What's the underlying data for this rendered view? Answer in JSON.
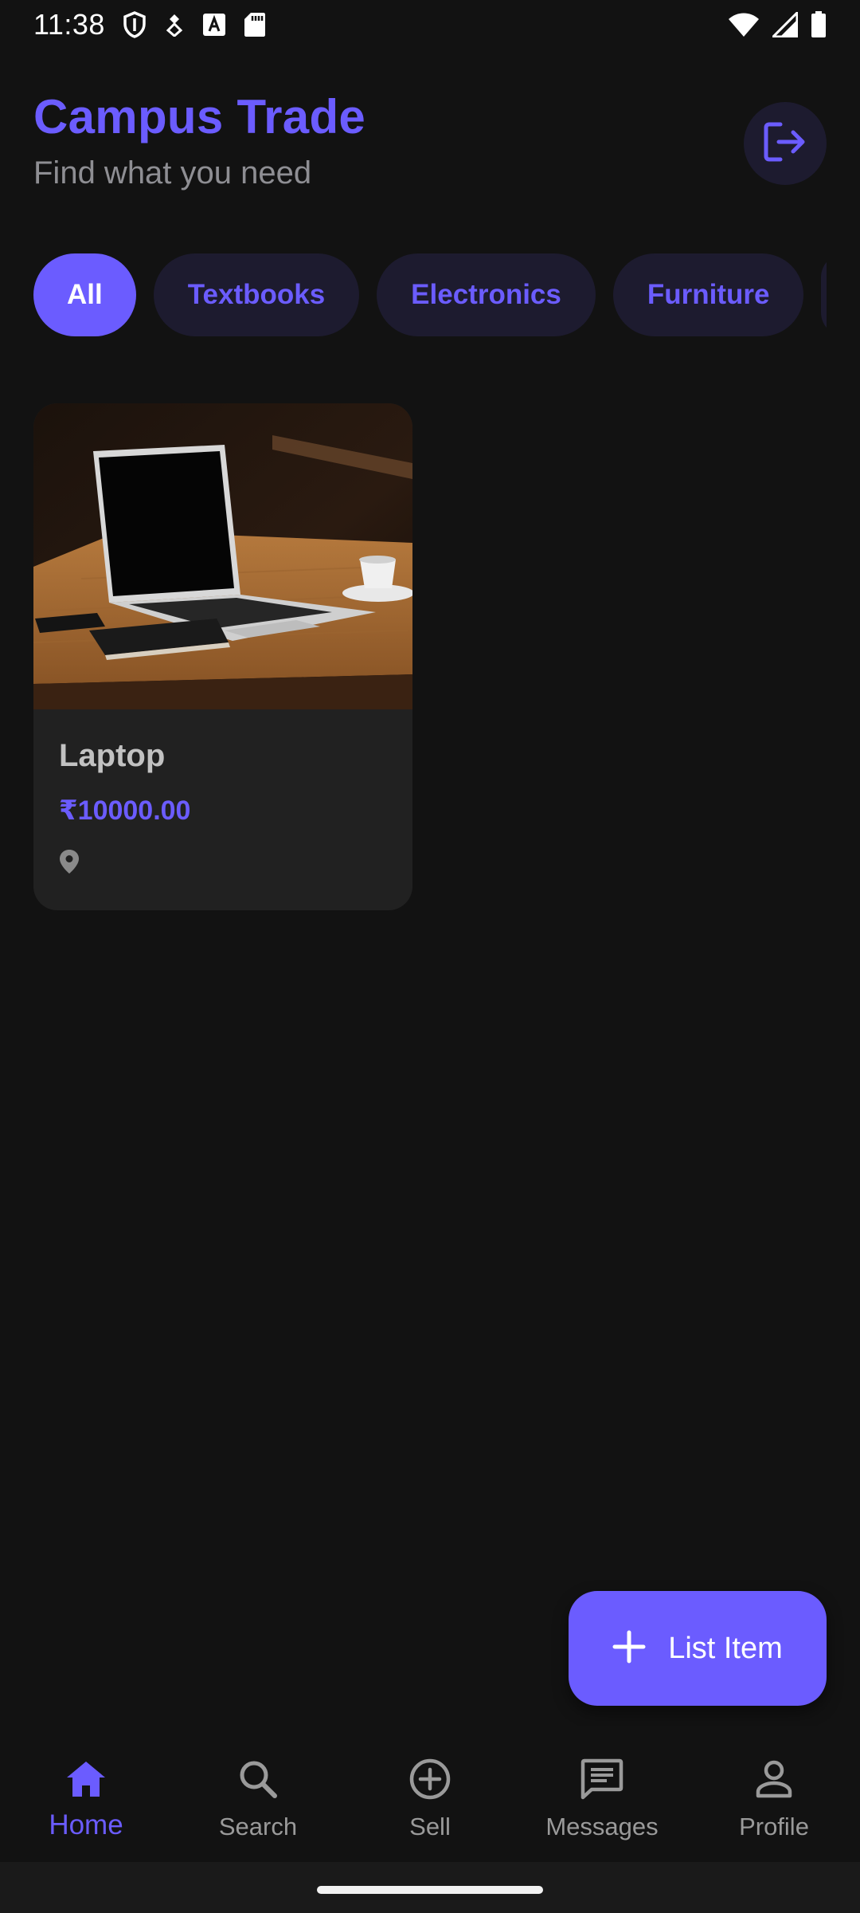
{
  "status_bar": {
    "time": "11:38",
    "left_icons": [
      "shield-icon",
      "diamond-icon",
      "font-a-icon",
      "sd-card-icon"
    ],
    "right_icons": [
      "wifi-icon",
      "signal-icon",
      "battery-icon"
    ]
  },
  "header": {
    "title": "Campus Trade",
    "subtitle": "Find what you need",
    "logout_icon": "logout-icon"
  },
  "categories": {
    "selected": "All",
    "items": [
      "All",
      "Textbooks",
      "Electronics",
      "Furniture"
    ]
  },
  "listings": [
    {
      "title": "Laptop",
      "price": "₹10000.00",
      "location": "",
      "image": "laptop-on-wooden-desk-photo"
    }
  ],
  "fab": {
    "label": "List Item",
    "icon": "plus-icon"
  },
  "bottom_nav": {
    "active": "Home",
    "items": [
      {
        "label": "Home",
        "icon": "home-icon"
      },
      {
        "label": "Search",
        "icon": "search-icon"
      },
      {
        "label": "Sell",
        "icon": "add-circle-icon"
      },
      {
        "label": "Messages",
        "icon": "chat-icon"
      },
      {
        "label": "Profile",
        "icon": "person-icon"
      }
    ]
  },
  "colors": {
    "accent": "#6b5cff",
    "background": "#121212",
    "card": "#212121",
    "chip_background": "#1d1b2f",
    "muted_text": "#8e8e93"
  }
}
